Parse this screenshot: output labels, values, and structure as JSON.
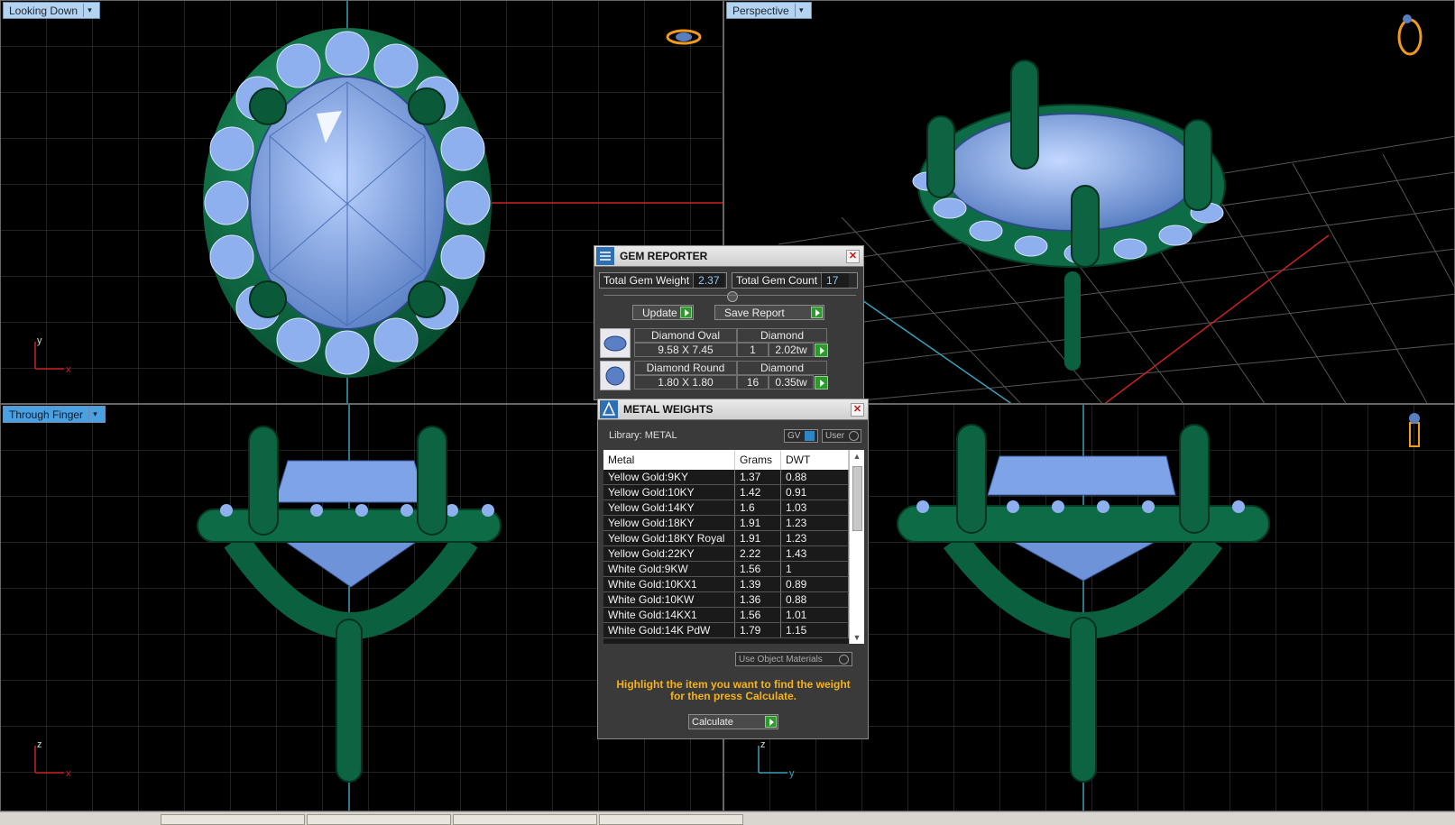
{
  "viewports": {
    "top_left": {
      "label": "Looking Down",
      "axes": {
        "h": "x",
        "v": "y"
      }
    },
    "top_right": {
      "label": "Perspective"
    },
    "bottom_left": {
      "label": "Through Finger",
      "axes": {
        "h": "x",
        "v": "z"
      }
    },
    "bottom_right": {
      "axes": {
        "h": "y",
        "v": "z"
      }
    }
  },
  "gem_reporter": {
    "title": "GEM REPORTER",
    "total_weight_label": "Total Gem Weight",
    "total_weight_value": "2.37",
    "total_count_label": "Total Gem Count",
    "total_count_value": "17",
    "update_label": "Update",
    "save_report_label": "Save Report",
    "gems": [
      {
        "name": "Diamond Oval",
        "material": "Diamond",
        "size": "9.58 X 7.45",
        "count": "1",
        "weight": "2.02tw"
      },
      {
        "name": "Diamond Round",
        "material": "Diamond",
        "size": "1.80 X 1.80",
        "count": "16",
        "weight": "0.35tw"
      }
    ]
  },
  "metal_weights": {
    "title": "METAL WEIGHTS",
    "library": "Library: METAL",
    "gv_label": "GV",
    "user_label": "User",
    "columns": [
      "Metal",
      "Grams",
      "DWT"
    ],
    "rows": [
      [
        "Yellow Gold:9KY",
        "1.37",
        "0.88"
      ],
      [
        "Yellow Gold:10KY",
        "1.42",
        "0.91"
      ],
      [
        "Yellow Gold:14KY",
        "1.6",
        "1.03"
      ],
      [
        "Yellow Gold:18KY",
        "1.91",
        "1.23"
      ],
      [
        "Yellow Gold:18KY Royal",
        "1.91",
        "1.23"
      ],
      [
        "Yellow Gold:22KY",
        "2.22",
        "1.43"
      ],
      [
        "White Gold:9KW",
        "1.56",
        "1"
      ],
      [
        "White Gold:10KX1",
        "1.39",
        "0.89"
      ],
      [
        "White Gold:10KW",
        "1.36",
        "0.88"
      ],
      [
        "White Gold:14KX1",
        "1.56",
        "1.01"
      ],
      [
        "White Gold:14K PdW",
        "1.79",
        "1.15"
      ]
    ],
    "use_object_materials_label": "Use Object Materials",
    "hint_line1": "Highlight the item you want to find the weight",
    "hint_line2": "for then press Calculate.",
    "calculate_label": "Calculate"
  },
  "colors": {
    "metal": "#0d6b45",
    "gem": "#7ea3e6",
    "grid": "#3d3d3d",
    "label_bg": "#b3d3f0",
    "hint": "#f5b21a"
  }
}
